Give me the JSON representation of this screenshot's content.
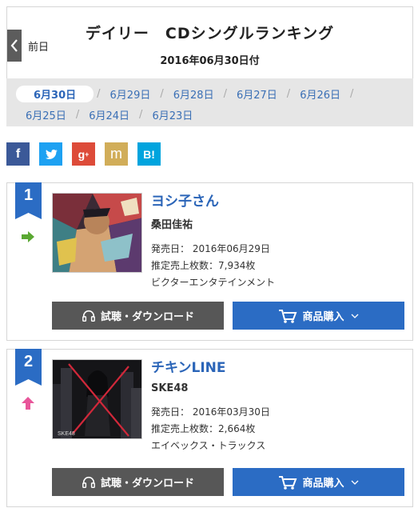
{
  "header": {
    "prev_label": "前日",
    "title": "デイリー　CDシングルランキング",
    "date": "2016年06月30日付"
  },
  "dates": {
    "row1": [
      "6月30日",
      "6月29日",
      "6月28日",
      "6月27日",
      "6月26日"
    ],
    "row2": [
      "6月25日",
      "6月24日",
      "6月23日"
    ],
    "active": "6月30日"
  },
  "social": [
    {
      "name": "facebook",
      "glyph": "f",
      "color": "#3b5998"
    },
    {
      "name": "twitter",
      "glyph": "t",
      "color": "#1da1f2"
    },
    {
      "name": "google-plus",
      "glyph": "g+",
      "color": "#dd4b39"
    },
    {
      "name": "mixi",
      "glyph": "m",
      "color": "#d1ad59"
    },
    {
      "name": "hatena",
      "glyph": "B!",
      "color": "#00a4de"
    }
  ],
  "rankings": [
    {
      "rank": "1",
      "trend": "same",
      "trend_color": "#5aa832",
      "title": "ヨシ子さん",
      "artist": "桑田佳祐",
      "release": "発売日：  2016年06月29日",
      "sales": "推定売上枚数：7,934枚",
      "label": "ビクターエンタテインメント",
      "listen_label": "試聴・ダウンロード",
      "buy_label": "商品購入"
    },
    {
      "rank": "2",
      "trend": "up",
      "trend_color": "#e8559a",
      "title": "チキンLINE",
      "artist": "SKE48",
      "release": "発売日：  2016年03月30日",
      "sales": "推定売上枚数：2,664枚",
      "label": "エイベックス・トラックス",
      "listen_label": "試聴・ダウンロード",
      "buy_label": "商品購入"
    }
  ],
  "colors": {
    "rank_badge": "#2b6cc4",
    "link": "#2b65b8"
  }
}
